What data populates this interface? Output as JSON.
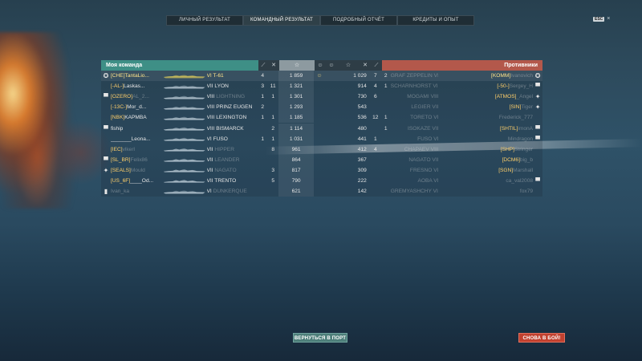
{
  "tabs": [
    {
      "label": "ЛИЧНЫЙ РЕЗУЛЬТАТ",
      "active": false
    },
    {
      "label": "КОМАНДНЫЙ РЕЗУЛЬТАТ",
      "active": true
    },
    {
      "label": "ПОДРОБНЫЙ ОТЧЁТ",
      "active": false
    },
    {
      "label": "КРЕДИТЫ И ОПЫТ",
      "active": false
    }
  ],
  "esc": {
    "key": "ESC",
    "close": "×"
  },
  "header": {
    "my_team": "Моя команда",
    "enemies": "Противники",
    "col_kills_icon": "⟋",
    "col_planes_icon": "✕",
    "col_xp_icon": "☆",
    "col_badge_icon": "☺",
    "col_enemy_badge_icon": "☺",
    "col_enemy_xp_icon": "☆",
    "col_enemy_planes_icon": "✕",
    "col_enemy_kills_icon": "⟋"
  },
  "colors": {
    "my_team": "#3e8f86",
    "enemy": "#b3584b",
    "gold": "#ffe48a"
  },
  "my_team": [
    {
      "medal": "✪",
      "clan": "[CHE]",
      "name": "TantaLio...",
      "tier": "VI",
      "ship": "T-61",
      "kills": "4",
      "planes": "",
      "xp": "1 859",
      "badge": "☺",
      "self": true
    },
    {
      "medal": "",
      "clan": "[-AL-]",
      "name": "Laskas...",
      "tier": "VII",
      "ship": "LYON",
      "kills": "3",
      "planes": "11",
      "xp": "1 321",
      "badge": ""
    },
    {
      "medal": "▀",
      "clan": "[OZERO]",
      "name": "AL_2...",
      "tier": "VIII",
      "ship": "LIGHTNING",
      "kills": "1",
      "planes": "1",
      "xp": "1 301",
      "badge": "",
      "dim": true
    },
    {
      "medal": "",
      "clan": "[-13C-]",
      "name": "Mor_d...",
      "tier": "VIII",
      "ship": "PRINZ EUGEN",
      "kills": "2",
      "planes": "",
      "xp": "1 293",
      "badge": ""
    },
    {
      "medal": "",
      "clan": "[NBK]",
      "name": "KAPMBA",
      "tier": "VIII",
      "ship": "LEXINGTON",
      "kills": "1",
      "planes": "1",
      "xp": "1 185",
      "badge": ""
    },
    {
      "medal": "▀",
      "clan": "",
      "name": "fiship",
      "tier": "VIII",
      "ship": "BISMARCK",
      "kills": "",
      "planes": "2",
      "xp": "1 114",
      "badge": ""
    },
    {
      "medal": "",
      "clan": "",
      "name": "_______Leona...",
      "tier": "VI",
      "ship": "FUSŌ",
      "kills": "1",
      "planes": "1",
      "xp": "1 031",
      "badge": ""
    },
    {
      "medal": "",
      "clan": "[IEC]",
      "name": "vlkerl",
      "tier": "VII",
      "ship": "HIPPER",
      "kills": "",
      "planes": "8",
      "xp": "961",
      "badge": "",
      "dim": true
    },
    {
      "medal": "▀",
      "clan": "[SL_BR]",
      "name": "Felix86",
      "tier": "VII",
      "ship": "LEANDER",
      "kills": "",
      "planes": "",
      "xp": "864",
      "badge": "",
      "dim": true
    },
    {
      "medal": "✦",
      "clan": "[SEALS]",
      "name": "Mould",
      "tier": "VII",
      "ship": "NAGATO",
      "kills": "",
      "planes": "3",
      "xp": "817",
      "badge": "",
      "dim": true
    },
    {
      "medal": "",
      "clan": "[US_6F]",
      "name": "____Od...",
      "tier": "VII",
      "ship": "TRENTO",
      "kills": "",
      "planes": "5",
      "xp": "790",
      "badge": ""
    },
    {
      "medal": "▮",
      "clan": "",
      "name": "Ivan_ka",
      "tier": "VI",
      "ship": "DUNKERQUE",
      "kills": "",
      "planes": "",
      "xp": "621",
      "badge": "",
      "dim": true
    }
  ],
  "enemies": [
    {
      "xp": "1 029",
      "planes": "7",
      "kills": "2",
      "tier": "VIII",
      "ship": "GRAF ZEPPELIN",
      "clan": "[KOMM]",
      "name": "Ivanovich",
      "medal": "✪"
    },
    {
      "xp": "914",
      "planes": "4",
      "kills": "1",
      "tier": "VIII",
      "ship": "SCHARNHORST",
      "clan": "[-50-]",
      "name": "Sergey_H",
      "medal": "▀"
    },
    {
      "xp": "730",
      "planes": "6",
      "kills": "",
      "tier": "VIII",
      "ship": "MOGAMI",
      "clan": "[ATMOS]",
      "name": "_Angel",
      "medal": "✦"
    },
    {
      "xp": "543",
      "planes": "",
      "kills": "",
      "tier": "VII",
      "ship": "LEGIER",
      "clan": "[SIN]",
      "name": "Tiger",
      "medal": "✦"
    },
    {
      "xp": "536",
      "planes": "12",
      "kills": "1",
      "tier": "VI",
      "ship": "TORETO",
      "clan": "",
      "name": "Frederick_777",
      "medal": ""
    },
    {
      "xp": "480",
      "planes": "",
      "kills": "1",
      "tier": "VII",
      "ship": "ISOKAZE",
      "clan": "[SHTIL]",
      "name": "imonA",
      "medal": "▀"
    },
    {
      "xp": "441",
      "planes": "1",
      "kills": "",
      "tier": "VI",
      "ship": "FUSŌ",
      "clan": "",
      "name": "Mindragon",
      "medal": "▀"
    },
    {
      "xp": "412",
      "planes": "4",
      "kills": "",
      "tier": "VIII",
      "ship": "CHAPAEV",
      "clan": "[SHP]",
      "name": "Stringer",
      "medal": ""
    },
    {
      "xp": "367",
      "planes": "",
      "kills": "",
      "tier": "VII",
      "ship": "NAGATO",
      "clan": "[DCM6]",
      "name": "big_b",
      "medal": ""
    },
    {
      "xp": "309",
      "planes": "",
      "kills": "",
      "tier": "VI",
      "ship": "FRESNO",
      "clan": "[SGN]",
      "name": "Marshall",
      "medal": ""
    },
    {
      "xp": "222",
      "planes": "",
      "kills": "",
      "tier": "VI",
      "ship": "AOBA",
      "clan": "",
      "name": "ca_val2008",
      "medal": "▀"
    },
    {
      "xp": "142",
      "planes": "",
      "kills": "",
      "tier": "VII",
      "ship": "GREMYASHCHY",
      "clan": "",
      "name": "fox79",
      "medal": ""
    }
  ],
  "buttons": {
    "port": "ВЕРНУТЬСЯ В ПОРТ",
    "battle": "СНОВА В БОЙ!"
  }
}
